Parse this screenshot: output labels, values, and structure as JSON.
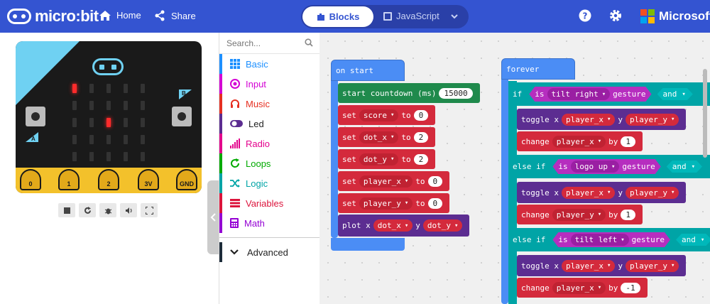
{
  "header": {
    "logo_text": "micro:bit",
    "home": "Home",
    "share": "Share",
    "mode_blocks": "Blocks",
    "mode_javascript": "JavaScript",
    "brand": "Microsoft"
  },
  "toolbox": {
    "search_placeholder": "Search...",
    "categories": [
      {
        "label": "Basic",
        "color": "#1e90ff"
      },
      {
        "label": "Input",
        "color": "#d400d4"
      },
      {
        "label": "Music",
        "color": "#e63022"
      },
      {
        "label": "Led",
        "color": "#5c2d91"
      },
      {
        "label": "Radio",
        "color": "#e3008c"
      },
      {
        "label": "Loops",
        "color": "#00aa00"
      },
      {
        "label": "Logic",
        "color": "#00a4a6"
      },
      {
        "label": "Variables",
        "color": "#dc143c"
      },
      {
        "label": "Math",
        "color": "#9400d3"
      }
    ],
    "advanced": "Advanced"
  },
  "simulator": {
    "pins": [
      "0",
      "1",
      "2",
      "3V",
      "GND"
    ],
    "button_a": "A",
    "button_b": "B"
  },
  "workspace": {
    "on_start": {
      "title": "on start",
      "countdown_label": "start countdown (ms)",
      "countdown_value": "15000",
      "set": "set",
      "to": "to",
      "assignments": [
        {
          "var": "score",
          "value": "0"
        },
        {
          "var": "dot_x",
          "value": "2"
        },
        {
          "var": "dot_y",
          "value": "2"
        },
        {
          "var": "player_x",
          "value": "0"
        },
        {
          "var": "player_y",
          "value": "0"
        }
      ],
      "plot": "plot x",
      "plot_y": "y",
      "plot_x_var": "dot_x",
      "plot_y_var": "dot_y"
    },
    "forever": {
      "title": "forever",
      "if": "if",
      "else_if": "else if",
      "is": "is",
      "gesture": "gesture",
      "and": "and",
      "toggle": "toggle x",
      "y": "y",
      "change": "change",
      "by": "by",
      "branches": [
        {
          "gesture": "tilt right",
          "toggle_x": "player_x",
          "toggle_y": "player_y",
          "change_var": "player_x",
          "change_by": "1"
        },
        {
          "gesture": "logo up",
          "toggle_x": "player_x",
          "toggle_y": "player_y",
          "change_var": "player_y",
          "change_by": "1"
        },
        {
          "gesture": "tilt left",
          "toggle_x": "player_x",
          "toggle_y": "player_y",
          "change_var": "player_x",
          "change_by": "-1"
        }
      ]
    }
  }
}
